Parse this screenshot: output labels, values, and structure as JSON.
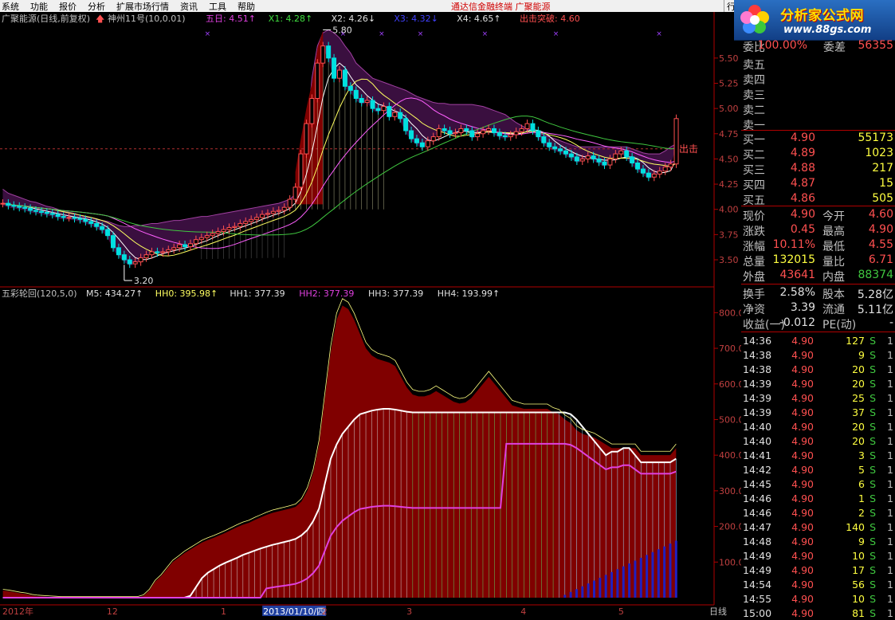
{
  "menu": {
    "items": [
      "系统",
      "功能",
      "报价",
      "分析",
      "扩展市场行情",
      "资讯",
      "工具",
      "帮助"
    ],
    "title": "通达信金融终端   广聚能源",
    "right_tab": "行"
  },
  "logo": {
    "name": "分析家公式网",
    "url": "www.88gs.com"
  },
  "colors": {
    "up": "#ff5050",
    "down": "#00e0e0",
    "yellow": "#ffff40",
    "green": "#40c840",
    "red_border": "#b00000"
  },
  "main_header": {
    "title": "广聚能源(日线,前复权)",
    "indicator": "神州11号(10,0.01)",
    "items": [
      {
        "text": "五日: 4.51↑",
        "color": "#e040e0"
      },
      {
        "text": "X1: 4.28↑",
        "color": "#40e040"
      },
      {
        "text": "X2: 4.26↓",
        "color": "#e0e0e0"
      },
      {
        "text": "X3: 4.32↓",
        "color": "#4040ff"
      },
      {
        "text": "X4: 4.65↑",
        "color": "#e0e0e0"
      },
      {
        "text": "出击突破: 4.60",
        "color": "#ff5050"
      }
    ]
  },
  "sub_header": {
    "title": "五彩轮回(120,5,0)",
    "items": [
      {
        "text": "M5: 434.27↑",
        "color": "#e0e0e0"
      },
      {
        "text": "HH0: 395.98↑",
        "color": "#ffff60"
      },
      {
        "text": "HH1: 377.39",
        "color": "#e0e0e0"
      },
      {
        "text": "HH2: 377.39",
        "color": "#e040e0"
      },
      {
        "text": "HH3: 377.39",
        "color": "#e0e0e0"
      },
      {
        "text": "HH4: 193.99↑",
        "color": "#e0e0e0"
      }
    ]
  },
  "annotations": {
    "high": "5.80",
    "low": "3.20",
    "signal": "出击"
  },
  "xaxis": {
    "labels": [
      {
        "text": "2012年",
        "t": 0.0
      },
      {
        "text": "12",
        "t": 0.16
      },
      {
        "text": "1",
        "t": 0.335
      },
      {
        "text": "2013/01/10/四",
        "t": 0.4,
        "highlight": true
      },
      {
        "text": "2",
        "t": 0.49
      },
      {
        "text": "3",
        "t": 0.62
      },
      {
        "text": "4",
        "t": 0.795
      },
      {
        "text": "5",
        "t": 0.945
      }
    ],
    "period": "日线"
  },
  "chart_data": [
    {
      "type": "candlestick",
      "name": "main",
      "yaxis": {
        "ticks": [
          5.5,
          5.25,
          5.0,
          4.75,
          4.5,
          4.25,
          4.0,
          3.75,
          3.5
        ]
      },
      "closes": [
        4.06,
        4.04,
        4.03,
        4.02,
        4.01,
        3.99,
        3.98,
        3.97,
        3.96,
        3.95,
        3.93,
        3.92,
        3.92,
        3.91,
        3.9,
        3.88,
        3.86,
        3.83,
        3.8,
        3.74,
        3.62,
        3.55,
        3.5,
        3.46,
        3.48,
        3.52,
        3.55,
        3.58,
        3.57,
        3.58,
        3.6,
        3.62,
        3.65,
        3.63,
        3.66,
        3.7,
        3.72,
        3.74,
        3.76,
        3.78,
        3.8,
        3.82,
        3.83,
        3.86,
        3.88,
        3.9,
        3.92,
        3.95,
        3.96,
        3.98,
        3.99,
        4.02,
        4.1,
        4.22,
        4.55,
        4.85,
        5.1,
        5.45,
        5.62,
        5.5,
        5.3,
        5.38,
        5.22,
        5.18,
        5.1,
        5.06,
        5.08,
        5.0,
        4.98,
        5.02,
        4.92,
        4.96,
        4.9,
        4.78,
        4.7,
        4.66,
        4.62,
        4.68,
        4.72,
        4.8,
        4.78,
        4.75,
        4.76,
        4.8,
        4.78,
        4.72,
        4.75,
        4.78,
        4.8,
        4.76,
        4.73,
        4.72,
        4.74,
        4.77,
        4.8,
        4.85,
        4.78,
        4.72,
        4.66,
        4.62,
        4.6,
        4.58,
        4.55,
        4.52,
        4.48,
        4.5,
        4.53,
        4.5,
        4.47,
        4.44,
        4.5,
        4.55,
        4.58,
        4.52,
        4.46,
        4.4,
        4.36,
        4.32,
        4.35,
        4.38,
        4.42,
        4.45,
        4.9
      ],
      "band_upper": [
        4.2,
        4.16,
        4.14,
        4.12,
        4.1,
        4.08,
        4.07,
        4.05,
        4.03,
        4.02,
        4.0,
        3.98,
        3.97,
        3.96,
        3.94,
        3.92,
        3.92,
        3.9,
        3.89,
        3.88,
        3.86,
        3.84,
        3.83,
        3.83,
        3.84,
        3.84,
        3.85,
        3.86,
        3.86,
        3.87,
        3.88,
        3.89,
        3.89,
        3.9,
        3.91,
        3.92,
        3.93,
        3.93,
        3.94,
        3.95,
        3.96,
        3.97,
        3.98,
        3.99,
        4.0,
        4.01,
        4.02,
        4.03,
        4.04,
        4.05,
        4.06,
        4.08,
        4.1,
        4.15,
        4.3,
        4.7,
        5.3,
        5.62,
        5.75,
        5.78,
        5.75,
        5.7,
        5.62,
        5.55,
        5.45,
        5.4,
        5.35,
        5.3,
        5.28,
        5.26,
        5.24,
        5.22,
        5.2,
        5.18,
        5.15,
        5.12,
        5.1,
        5.08,
        5.06,
        5.05,
        5.05,
        5.04,
        5.04,
        5.04,
        5.04,
        5.04,
        5.03,
        5.02,
        5.0,
        4.98,
        4.96,
        4.94,
        4.9,
        4.86,
        4.83,
        4.8,
        4.78,
        4.76,
        4.74,
        4.72,
        4.7,
        4.68,
        4.66,
        4.64,
        4.62,
        4.62,
        4.62,
        4.62,
        4.62,
        4.62,
        4.62,
        4.62,
        4.62,
        4.62,
        4.6,
        4.58,
        4.56,
        4.55,
        4.55,
        4.55,
        4.58,
        4.62,
        4.65
      ],
      "ylim": [
        3.35,
        5.72
      ]
    },
    {
      "type": "area",
      "name": "sub",
      "yaxis": {
        "ticks": [
          800,
          700,
          600,
          500,
          400,
          300,
          200,
          100
        ]
      },
      "series": [
        {
          "name": "HH0",
          "values": [
            20,
            18,
            15,
            12,
            10,
            6,
            4,
            3,
            2,
            1,
            0,
            0,
            0,
            0,
            0,
            0,
            0,
            0,
            0,
            0,
            0,
            0,
            0,
            0,
            5,
            20,
            45,
            60,
            80,
            100,
            112,
            125,
            135,
            145,
            155,
            162,
            168,
            175,
            182,
            190,
            198,
            205,
            210,
            218,
            225,
            232,
            238,
            242,
            246,
            250,
            255,
            270,
            300,
            350,
            430,
            560,
            690,
            780,
            820,
            810,
            780,
            740,
            700,
            680,
            670,
            665,
            660,
            650,
            620,
            590,
            570,
            565,
            565,
            570,
            580,
            570,
            560,
            550,
            545,
            548,
            560,
            580,
            600,
            620,
            600,
            580,
            560,
            540,
            535,
            530,
            530,
            530,
            530,
            530,
            520,
            515,
            500,
            490,
            470,
            460,
            455,
            450,
            440,
            430,
            420,
            420,
            420,
            420,
            420,
            400,
            400,
            400,
            400,
            400,
            400,
            420
          ],
          "fill": "#800000"
        },
        {
          "name": "HH1",
          "values": [
            0,
            0,
            0,
            0,
            0,
            0,
            0,
            0,
            0,
            0,
            0,
            0,
            0,
            0,
            0,
            0,
            0,
            0,
            0,
            0,
            0,
            0,
            0,
            0,
            0,
            0,
            0,
            0,
            0,
            0,
            0,
            0,
            5,
            30,
            55,
            70,
            80,
            90,
            98,
            105,
            112,
            120,
            126,
            132,
            138,
            143,
            148,
            152,
            156,
            160,
            165,
            175,
            190,
            215,
            250,
            320,
            390,
            430,
            460,
            480,
            500,
            515,
            520,
            525,
            528,
            530,
            530,
            528,
            525,
            522,
            520,
            520,
            520,
            520,
            520,
            520,
            520,
            520,
            520,
            520,
            520,
            520,
            520,
            520,
            520,
            520,
            520,
            520,
            520,
            520,
            520,
            520,
            520,
            520,
            520,
            520,
            520,
            515,
            500,
            480,
            460,
            440,
            420,
            400,
            410,
            410,
            420,
            420,
            400,
            380,
            380,
            380,
            380,
            380,
            380,
            390
          ],
          "fill": "#c0c0c0"
        }
      ],
      "ylim": [
        0,
        850
      ]
    }
  ],
  "quote": {
    "code_row": {
      "a": "委比",
      "b": "100.00%",
      "c": "委差",
      "d": "56355"
    },
    "sell": [
      {
        "label": "卖五"
      },
      {
        "label": "卖四"
      },
      {
        "label": "卖三"
      },
      {
        "label": "卖二"
      },
      {
        "label": "卖一"
      }
    ],
    "buy": [
      {
        "label": "买一",
        "price": "4.90",
        "vol": "55173"
      },
      {
        "label": "买二",
        "price": "4.89",
        "vol": "1023"
      },
      {
        "label": "买三",
        "price": "4.88",
        "vol": "217"
      },
      {
        "label": "买四",
        "price": "4.87",
        "vol": "15"
      },
      {
        "label": "买五",
        "price": "4.86",
        "vol": "505"
      }
    ],
    "stats": [
      {
        "l1": "现价",
        "v1": "4.90",
        "c1": "#ff5050",
        "l2": "今开",
        "v2": "4.60",
        "c2": "#ff5050"
      },
      {
        "l1": "涨跌",
        "v1": "0.45",
        "c1": "#ff5050",
        "l2": "最高",
        "v2": "4.90",
        "c2": "#ff5050"
      },
      {
        "l1": "涨幅",
        "v1": "10.11%",
        "c1": "#ff5050",
        "l2": "最低",
        "v2": "4.55",
        "c2": "#ff5050"
      },
      {
        "l1": "总量",
        "v1": "132015",
        "c1": "#ffff40",
        "l2": "量比",
        "v2": "6.71",
        "c2": "#ff5050"
      },
      {
        "l1": "外盘",
        "v1": "43641",
        "c1": "#ff5050",
        "l2": "内盘",
        "v2": "88374",
        "c2": "#40c840"
      }
    ],
    "stats2": [
      {
        "l1": "换手",
        "v1": "2.58%",
        "c1": "#e0e0e0",
        "l2": "股本",
        "v2": "5.28亿",
        "c2": "#e0e0e0"
      },
      {
        "l1": "净资",
        "v1": "3.39",
        "c1": "#e0e0e0",
        "l2": "流通",
        "v2": "5.11亿",
        "c2": "#e0e0e0"
      },
      {
        "l1": "收益(一)",
        "v1": "-0.012",
        "c1": "#e0e0e0",
        "l2": "PE(动)",
        "v2": "-",
        "c2": "#e0e0e0"
      }
    ],
    "ticks": [
      {
        "t": "14:36",
        "p": "4.90",
        "v": "127",
        "s": "S",
        "n": "1"
      },
      {
        "t": "14:38",
        "p": "4.90",
        "v": "9",
        "s": "S",
        "n": "1"
      },
      {
        "t": "14:38",
        "p": "4.90",
        "v": "20",
        "s": "S",
        "n": "1"
      },
      {
        "t": "14:39",
        "p": "4.90",
        "v": "20",
        "s": "S",
        "n": "1"
      },
      {
        "t": "14:39",
        "p": "4.90",
        "v": "25",
        "s": "S",
        "n": "1"
      },
      {
        "t": "14:39",
        "p": "4.90",
        "v": "37",
        "s": "S",
        "n": "1"
      },
      {
        "t": "14:40",
        "p": "4.90",
        "v": "20",
        "s": "S",
        "n": "1"
      },
      {
        "t": "14:40",
        "p": "4.90",
        "v": "20",
        "s": "S",
        "n": "1"
      },
      {
        "t": "14:41",
        "p": "4.90",
        "v": "3",
        "s": "S",
        "n": "1"
      },
      {
        "t": "14:42",
        "p": "4.90",
        "v": "5",
        "s": "S",
        "n": "1"
      },
      {
        "t": "14:45",
        "p": "4.90",
        "v": "6",
        "s": "S",
        "n": "1"
      },
      {
        "t": "14:46",
        "p": "4.90",
        "v": "1",
        "s": "S",
        "n": "1"
      },
      {
        "t": "14:46",
        "p": "4.90",
        "v": "2",
        "s": "S",
        "n": "1"
      },
      {
        "t": "14:47",
        "p": "4.90",
        "v": "140",
        "s": "S",
        "n": "1"
      },
      {
        "t": "14:48",
        "p": "4.90",
        "v": "9",
        "s": "S",
        "n": "1"
      },
      {
        "t": "14:49",
        "p": "4.90",
        "v": "10",
        "s": "S",
        "n": "1"
      },
      {
        "t": "14:49",
        "p": "4.90",
        "v": "17",
        "s": "S",
        "n": "1"
      },
      {
        "t": "14:54",
        "p": "4.90",
        "v": "56",
        "s": "S",
        "n": "1"
      },
      {
        "t": "14:55",
        "p": "4.90",
        "v": "10",
        "s": "S",
        "n": "1"
      },
      {
        "t": "15:00",
        "p": "4.90",
        "v": "81",
        "s": "S",
        "n": "1"
      }
    ]
  }
}
